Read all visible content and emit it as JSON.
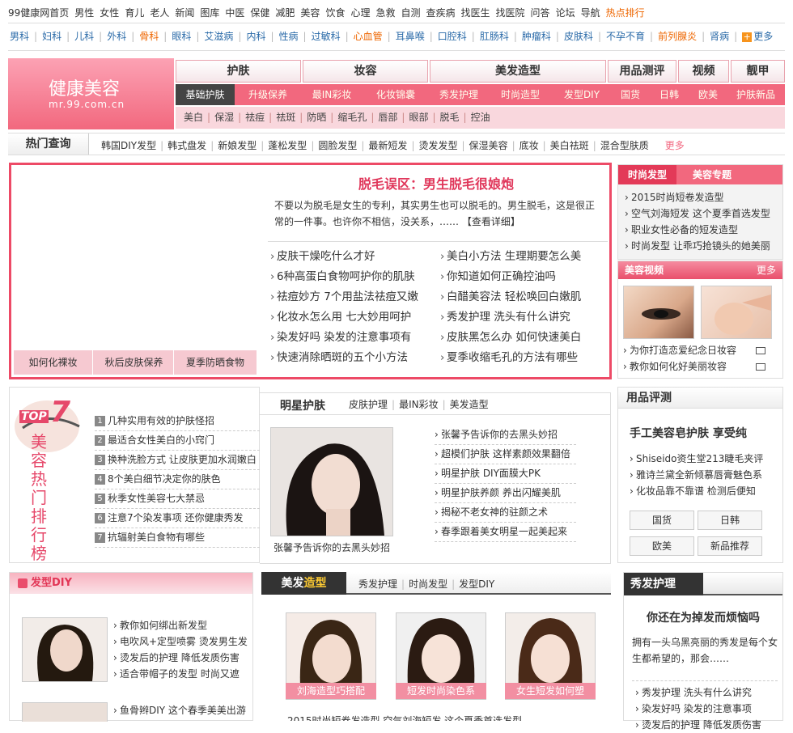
{
  "topnav": {
    "items": [
      "99健康网首页",
      "男性",
      "女性",
      "育儿",
      "老人",
      "新闻",
      "图库",
      "中医",
      "保健",
      "减肥",
      "美容",
      "饮食",
      "心理",
      "急救",
      "自测",
      "查疾病",
      "找医生",
      "找医院",
      "问答",
      "论坛",
      "导航"
    ],
    "hot": "热点排行"
  },
  "subnav": {
    "items": [
      "男科",
      "妇科",
      "儿科",
      "外科",
      "骨科",
      "眼科",
      "艾滋病",
      "内科",
      "性病",
      "过敏科",
      "心血管",
      "耳鼻喉",
      "口腔科",
      "肛肠科",
      "肿瘤科",
      "皮肤科",
      "不孕不育",
      "前列腺炎",
      "肾病"
    ],
    "orange": [
      "骨科",
      "心血管",
      "前列腺炎"
    ],
    "more": "更多"
  },
  "logo": {
    "title": "健康美容",
    "url": "mr.99.com.cn"
  },
  "maintabs": [
    "护肤",
    "妆容",
    "美发造型",
    "用品测评",
    "视频",
    "靓甲"
  ],
  "row2": [
    "基础护肤",
    "升级保养",
    "最IN彩妆",
    "化妆锦囊",
    "秀发护理",
    "时尚造型",
    "发型DIY",
    "国货",
    "日韩",
    "欧美",
    "护肤新品"
  ],
  "row3": [
    "美白",
    "保湿",
    "祛痘",
    "祛斑",
    "防晒",
    "缩毛孔",
    "唇部",
    "眼部",
    "脱毛",
    "控油"
  ],
  "hotq": {
    "label": "热门查询",
    "items": [
      "韩国DIY发型",
      "韩式盘发",
      "新娘发型",
      "蓬松发型",
      "圆脸发型",
      "最新短发",
      "烫发发型",
      "保湿美容",
      "底妆",
      "美白祛斑",
      "混合型肤质"
    ],
    "more": "更多"
  },
  "feature": {
    "captions": [
      "如何化裸妆",
      "秋后皮肤保养",
      "夏季防晒食物"
    ],
    "title": "脱毛误区：男生脱毛很娘炮",
    "desc": "不要以为脱毛是女生的专利，其实男生也可以脱毛的。男生脱毛，这是很正常的一件事。也许你不相信，没关系，……",
    "detail": "【查看详细】",
    "left": [
      "皮肤干燥吃什么才好",
      "6种高蛋白食物呵护你的肌肤",
      "祛痘妙方 7个用盐法祛痘又嫩",
      "化妆水怎么用 七大妙用呵护",
      "染发好吗 染发的注意事项有",
      "快速消除晒斑的五个小方法"
    ],
    "right": [
      "美白小方法 生理期要怎么美",
      "你知道如何正确控油吗",
      "白醋美容法 轻松唤回白嫩肌",
      "秀发护理 洗头有什么讲究",
      "皮肤黑怎么办 如何快速美白",
      "夏季收缩毛孔的方法有哪些"
    ]
  },
  "side1": {
    "tabs": [
      "时尚发型",
      "美容专题"
    ],
    "items": [
      "2015时尚短卷发造型",
      "空气刘海短发 这个夏季首选发型",
      "职业女性必备的短发造型",
      "时尚发型 让乖巧抢镜头的她美丽"
    ]
  },
  "side2": {
    "title": "美容视频",
    "more": "更多",
    "items": [
      "为你打造恋爱纪念日妆容",
      "教你如何化好美丽妆容"
    ]
  },
  "top7": {
    "badge": "TOP",
    "num": "7",
    "vtext": "美容热门排行榜",
    "items": [
      "几种实用有效的护肤怪招",
      "最适合女性美白的小窍门",
      "换种洗脸方式 让皮肤更加水润嫩白",
      "8个美白细节决定你的肤色",
      "秋季女性美容七大禁忌",
      "注意7个染发事项 还你健康秀发",
      "抗辐射美白食物有哪些"
    ]
  },
  "star": {
    "title": "明星护肤",
    "tabs": [
      "皮肤护理",
      "最IN彩妆",
      "美发造型"
    ],
    "caption": "张馨予告诉你的去黑头妙招",
    "items": [
      "张馨予告诉你的去黑头妙招",
      "超模们护肤 这样素颜效果翻倍",
      "明星护肤 DIY面膜大PK",
      "明星护肤养颜 养出闪耀美肌",
      "揭秘不老女神的驻颜之术",
      "春季跟着美女明星一起美起来"
    ]
  },
  "ping": {
    "title": "用品评测",
    "headline": "手工美容皂护肤 享受纯",
    "items": [
      "Shiseido资生堂213睫毛夹评",
      "雅诗兰黛全新倾慕唇膏魅色系",
      "化妆品靠不靠谱 检测后便知"
    ],
    "buttons": [
      "国货",
      "日韩",
      "欧美",
      "新品推荐"
    ]
  },
  "fx": {
    "title": "发型DIY",
    "items": [
      "教你如何绑出新发型",
      "电吹风+定型喷雾 烫发男生发",
      "烫发后的护理 降低发质伤害",
      "适合带帽子的发型 时尚又遮"
    ],
    "item2": "鱼骨辫DIY 这个春季美美出游"
  },
  "mf": {
    "label1": "美发",
    "label2": "造型",
    "tabs": [
      "秀发护理",
      "时尚发型",
      "发型DIY"
    ],
    "captions": [
      "刘海造型巧搭配",
      "短发时尚染色系",
      "女生短发如何塑"
    ],
    "more": "2015时尚短卷发造型   空气刘海短发 这个夏季首选发型"
  },
  "xf": {
    "title": "秀发护理",
    "headline": "你还在为掉发而烦恼吗",
    "desc": "拥有一头乌黑亮丽的秀发是每个女生都希望的，那会……",
    "items": [
      "秀发护理 洗头有什么讲究",
      "染发好吗 染发的注意事项",
      "烫发后的护理 降低发质伤害"
    ]
  },
  "colors": {
    "accent": "#f2687e",
    "dark_accent": "#e33a58",
    "hot": "#ee6600"
  }
}
